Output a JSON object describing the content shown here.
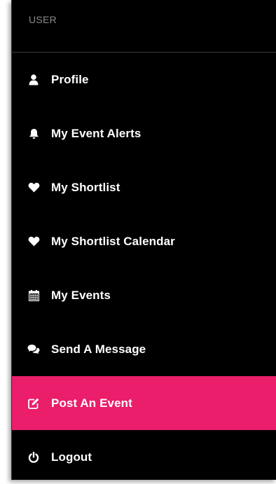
{
  "sidebar": {
    "section_label": "USER",
    "active_color": "#ea1e6b",
    "items": [
      {
        "label": "Profile",
        "icon": "user-icon"
      },
      {
        "label": "My Event Alerts",
        "icon": "bell-icon"
      },
      {
        "label": "My Shortlist",
        "icon": "heart-icon"
      },
      {
        "label": "My Shortlist Calendar",
        "icon": "heart-icon"
      },
      {
        "label": "My Events",
        "icon": "calendar-icon"
      },
      {
        "label": "Send A Message",
        "icon": "comments-icon"
      },
      {
        "label": "Post An Event",
        "icon": "edit-icon",
        "active": true
      },
      {
        "label": "Logout",
        "icon": "power-icon"
      }
    ]
  }
}
